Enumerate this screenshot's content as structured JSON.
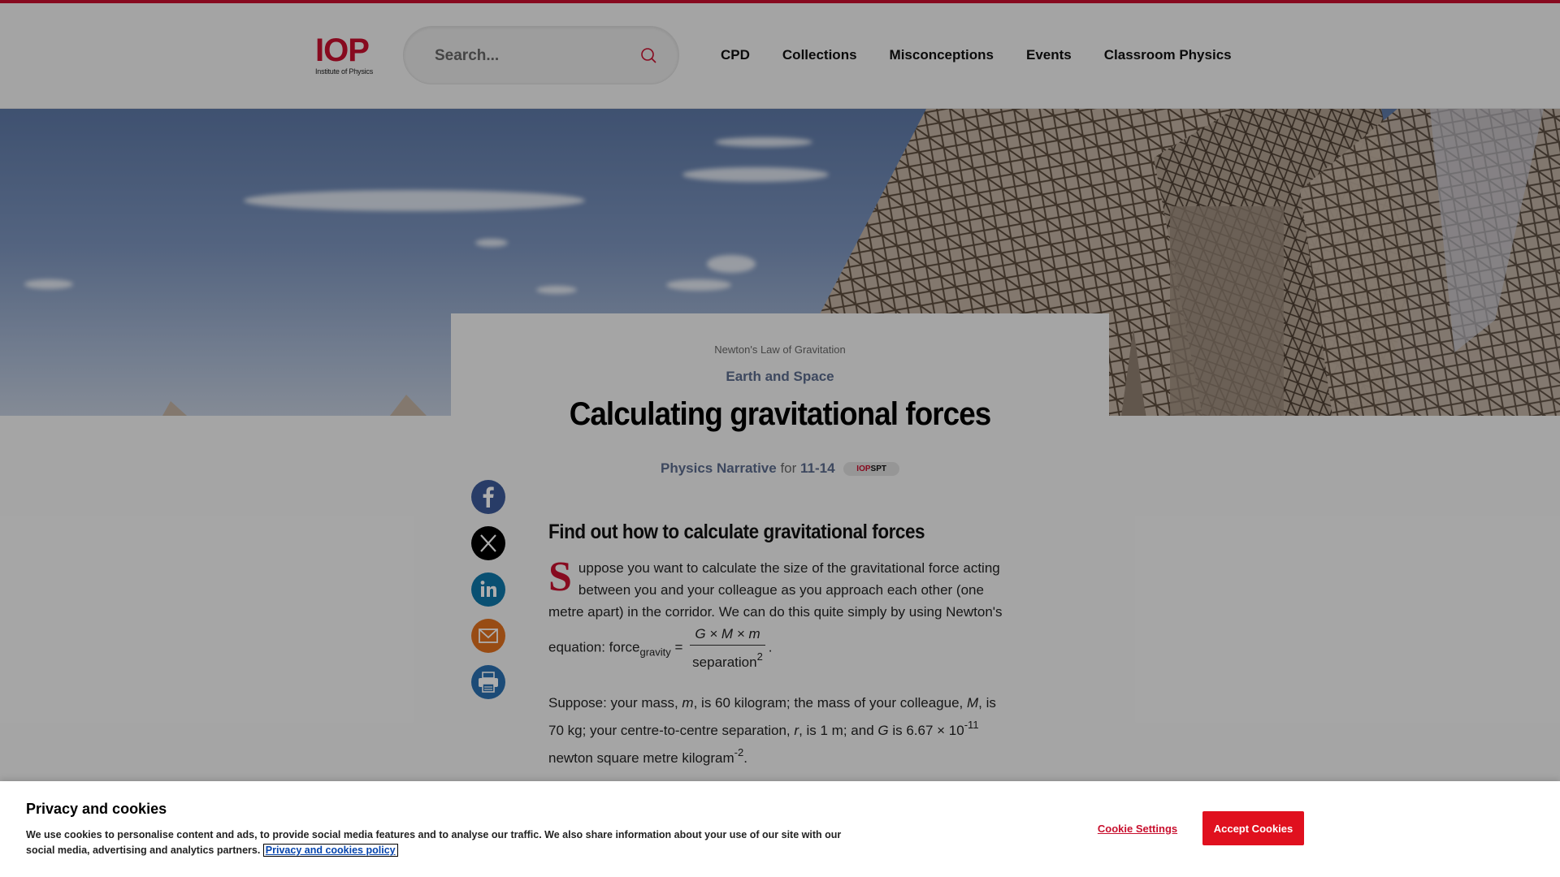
{
  "header": {
    "logo_mark": "IOP",
    "logo_sub": "Institute of Physics",
    "search_placeholder": "Search...",
    "nav": [
      "CPD",
      "Collections",
      "Misconceptions",
      "Events",
      "Classroom Physics"
    ]
  },
  "article": {
    "kicker": "Newton's Law of Gravitation",
    "category": "Earth and Space",
    "title": "Calculating gravitational forces",
    "type": "Physics Narrative",
    "for_word": "for",
    "age": "11-14",
    "badge_red": "IOP",
    "badge_dark": "SPT",
    "subheading": "Find out how to calculate gravitational forces",
    "dropcap": "S",
    "p1_text": "uppose you want to calculate the size of the gravitational force acting between you and your colleague as you approach each other (one metre apart) in the corridor. We can do this quite simply by using Newton's equation: force",
    "p1_sub": "gravity",
    "p1_eq": "=",
    "frac_num": "G  ×  M  ×  m",
    "frac_den": "separation",
    "frac_den_sup": "2",
    "p1_end": ".",
    "p2_a": "Suppose: your mass, ",
    "p2_m": "m",
    "p2_b": ", is 60 kilogram; the mass of your colleague, ",
    "p2_M": "M",
    "p2_c": ", is 70 kg; your centre-to-centre separation, ",
    "p2_r": "r",
    "p2_d": ", is 1 m; and ",
    "p2_G": "G",
    "p2_e": " is 6.67 × 10",
    "p2_exp1": "-11",
    "p2_f": " newton square metre kilogram",
    "p2_exp2": "-2",
    "p2_g": "."
  },
  "share_icons": [
    "facebook-icon",
    "x-icon",
    "linkedin-icon",
    "email-icon",
    "print-icon"
  ],
  "colors": {
    "brand_red": "#c8102e",
    "facebook": "#3b5998",
    "x": "#000000",
    "linkedin": "#0e76a8",
    "email": "#e0701e",
    "print": "#2a6fb0",
    "accept": "#e0101e"
  },
  "cookie": {
    "title": "Privacy and cookies",
    "text": "We use cookies to personalise content and ads, to provide social media features and to analyse our traffic. We also share information about your use of our site with our social media, advertising and analytics partners.",
    "link": "Privacy and cookies policy",
    "settings_label": "Cookie Settings",
    "accept_label": "Accept Cookies"
  }
}
